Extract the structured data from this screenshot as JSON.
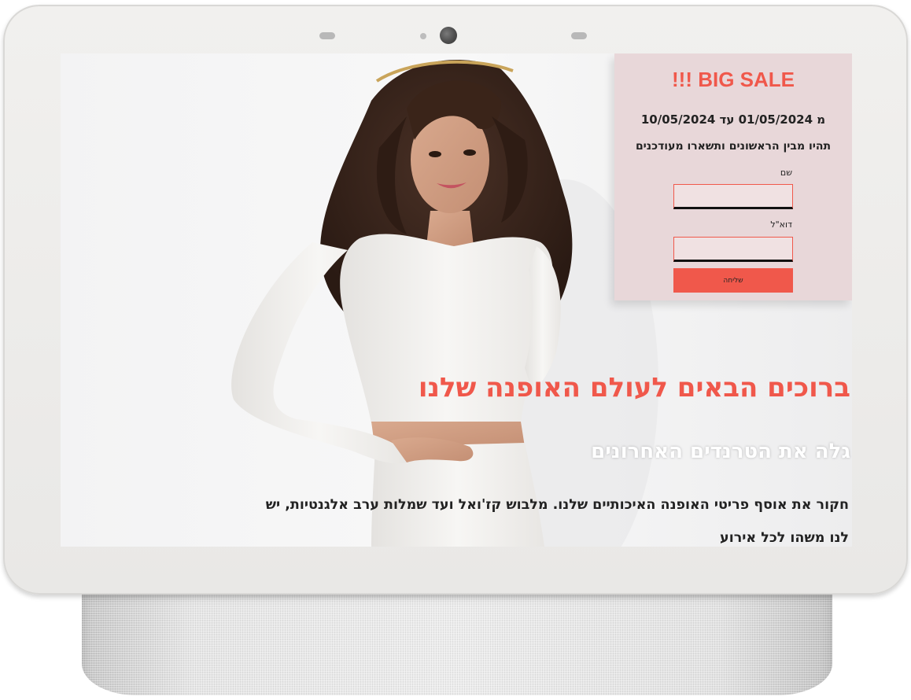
{
  "signup": {
    "title": "!!! BIG SALE",
    "dates": "מ 01/05/2024 עד 10/05/2024",
    "tagline": "תהיו מבין הראשונים ותשארו מעודכנים",
    "name_label": "שם",
    "name_value": "",
    "email_label": "דוא\"ל",
    "email_value": "",
    "submit_label": "שליחה"
  },
  "hero": {
    "title": "ברוכים הבאים לעולם האופנה שלנו",
    "subtitle": "גלה את הטרנדים האחרונים",
    "body": "חקור את אוסף פריטי האופנה האיכותיים שלנו. מלבוש קז'ואל ועד שמלות ערב אלגנטיות, יש לנו משהו לכל אירוע"
  },
  "colors": {
    "accent": "#f0584b",
    "card_background": "#e8d7d9",
    "device_frame": "#eceae8"
  }
}
